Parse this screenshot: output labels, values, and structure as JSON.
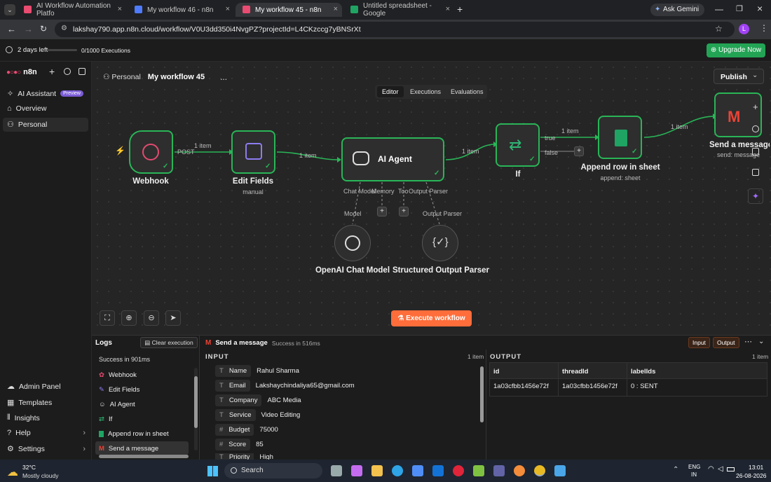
{
  "browser": {
    "tabs": [
      {
        "label": "AI Workflow Automation Platfo",
        "active": false
      },
      {
        "label": "My workflow 46 - n8n",
        "active": false
      },
      {
        "label": "My workflow 45 - n8n",
        "active": true
      },
      {
        "label": "Untitled spreadsheet - Google",
        "active": false
      }
    ],
    "ask_gemini": "Ask Gemini",
    "url": "lakshay790.app.n8n.cloud/workflow/V0U3dd350i4NvgPZ?projectId=L4CKzccg7yBNSrXt",
    "profile_initial": "L"
  },
  "trial": {
    "days_left": "2 days left",
    "executions": "0/1000 Executions",
    "upgrade": "Upgrade Now"
  },
  "sidebar": {
    "logo": "n8n",
    "top_items": [
      {
        "label": "AI Assistant",
        "badge": "Preview"
      },
      {
        "label": "Overview"
      },
      {
        "label": "Personal"
      }
    ],
    "bottom_items": [
      {
        "label": "Admin Panel"
      },
      {
        "label": "Templates"
      },
      {
        "label": "Insights"
      },
      {
        "label": "Help"
      },
      {
        "label": "Settings"
      }
    ]
  },
  "header": {
    "project": "Personal",
    "workflow_name": "My workflow 45",
    "more": "...",
    "publish": "Publish",
    "tabs": [
      "Editor",
      "Executions",
      "Evaluations"
    ]
  },
  "nodes": {
    "webhook": {
      "label": "Webhook"
    },
    "edit_fields": {
      "label": "Edit Fields",
      "sub": "manual"
    },
    "ai_agent": {
      "label": "AI Agent"
    },
    "if": {
      "label": "If"
    },
    "append": {
      "label": "Append row in sheet",
      "sub": "append: sheet"
    },
    "gmail": {
      "label": "Send a message",
      "sub": "send: message"
    },
    "openai": {
      "label": "OpenAI Chat Model"
    },
    "parser": {
      "label": "Structured Output Parser"
    }
  },
  "edges": {
    "post": "POST",
    "item1": "1 item",
    "item2": "1 item",
    "item3": "1 item",
    "item4": "1 item",
    "item5": "1 item",
    "true": "true",
    "false": "false",
    "chat_model": "Chat Model",
    "memory": "Memory",
    "tool": "Too",
    "output_parser": "Output Parser",
    "model": "Model",
    "output_parser2": "Output Parser"
  },
  "execute": "Execute workflow",
  "logs": {
    "title": "Logs",
    "clear": "Clear execution",
    "status": "Success in 901ms",
    "items": [
      "Webhook",
      "Edit Fields",
      "AI Agent",
      "If",
      "Append row in sheet",
      "Send a message"
    ]
  },
  "detail": {
    "node": "Send a message",
    "status": "Success in 516ms",
    "input_btn": "Input",
    "output_btn": "Output",
    "input_title": "INPUT",
    "input_count": "1 item",
    "output_title": "OUTPUT",
    "output_count": "1 item",
    "fields": [
      {
        "type": "T",
        "key": "Name",
        "value": "Rahul Sharma"
      },
      {
        "type": "T",
        "key": "Email",
        "value": "Lakshaychindaliya65@gmail.com"
      },
      {
        "type": "T",
        "key": "Company",
        "value": "ABC Media"
      },
      {
        "type": "T",
        "key": "Service",
        "value": "Video Editing"
      },
      {
        "type": "#",
        "key": "Budget",
        "value": "75000"
      },
      {
        "type": "#",
        "key": "Score",
        "value": "85"
      },
      {
        "type": "T",
        "key": "Priority",
        "value": "High"
      }
    ],
    "columns": [
      "id",
      "threadId",
      "labelIds"
    ],
    "row": [
      "1a03cfbb1456e72f",
      "1a03cfbb1456e72f",
      "0 : SENT"
    ]
  },
  "taskbar": {
    "weather_temp": "32°C",
    "weather_desc": "Mostly cloudy",
    "search": "Search",
    "lang1": "ENG",
    "lang2": "IN",
    "time": "13:01",
    "date": "26-08-2026"
  }
}
